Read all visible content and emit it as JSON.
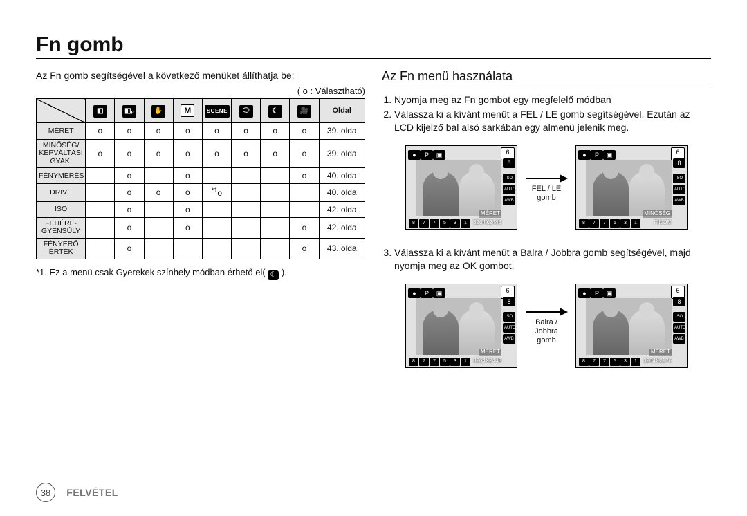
{
  "page": {
    "number": "38",
    "section": "_FELVÉTEL",
    "title": "Fn gomb"
  },
  "left": {
    "intro": "Az Fn gomb segítségével a következő menüket állíthatja be:",
    "legend": "( o : Választható)",
    "table": {
      "page_header": "Oldal",
      "mode_icons": [
        "camera",
        "camera-p",
        "hand",
        "m",
        "scene",
        "balloon",
        "night",
        "movie"
      ],
      "rows": [
        {
          "label": "MÉRET",
          "cells": [
            "o",
            "o",
            "o",
            "o",
            "o",
            "o",
            "o",
            "o"
          ],
          "page": "39. olda"
        },
        {
          "label": "MINŐSÉG/\nKÉPVÁLTÁSI\nGYAK.",
          "cells": [
            "o",
            "o",
            "o",
            "o",
            "o",
            "o",
            "o",
            "o"
          ],
          "page": "39. olda"
        },
        {
          "label": "FÉNYMÉRÉS",
          "cells": [
            "",
            "o",
            "",
            "o",
            "",
            "",
            "",
            "o"
          ],
          "page": "40. olda"
        },
        {
          "label": "DRIVE",
          "cells": [
            "",
            "o",
            "o",
            "o",
            "*1o",
            "",
            "",
            ""
          ],
          "page": "40. olda"
        },
        {
          "label": "ISO",
          "cells": [
            "",
            "o",
            "",
            "o",
            "",
            "",
            "",
            ""
          ],
          "page": "42. olda"
        },
        {
          "label": "FEHÉRE-\nGYENSÚLY",
          "cells": [
            "",
            "o",
            "",
            "o",
            "",
            "",
            "",
            "o"
          ],
          "page": "42. olda"
        },
        {
          "label": "FÉNYERŐ\nÉRTÉK",
          "cells": [
            "",
            "o",
            "",
            "",
            "",
            "",
            "",
            "o"
          ],
          "page": "43. olda"
        }
      ]
    },
    "footnote_prefix": "*1. Ez a menü csak Gyerekek színhely módban érhető el( ",
    "footnote_suffix": " )."
  },
  "right": {
    "heading": "Az Fn menü használata",
    "step1": "Nyomja meg az Fn gombot egy megfelelő módban",
    "step2": "Válassza ki a kívánt menüt a FEL / LE gomb segítségével. Ezután az LCD kijelző bal alsó sarkában egy almenü jelenik meg.",
    "step3": "Válassza ki a kívánt menüt a Balra / Jobbra gomb segítségével, majd nyomja meg az OK gombot.",
    "fig1": {
      "arrow_label": "FEL / LE\ngomb",
      "left_lcd": {
        "bottom_label": "MÉRET",
        "res": "3264X2448",
        "iso": "ISO\nAUTO",
        "awb": "AWB"
      },
      "right_lcd": {
        "bottom_label": "MINŐSÉG",
        "res": "FINOM",
        "iso": "ISO\nAUTO",
        "awb": "AWB"
      }
    },
    "fig2": {
      "arrow_label": "Balra /\nJobbra\ngomb",
      "left_lcd": {
        "bottom_label": "MÉRET",
        "res": "3264X2448",
        "iso": "ISO\nAUTO",
        "awb": "AWB"
      },
      "right_lcd": {
        "bottom_label": "MÉRET",
        "res": "3264X2176",
        "iso": "ISO\nAUTO",
        "awb": "AWB"
      }
    },
    "lcd_common": {
      "eight": "8",
      "size_chips": [
        "8",
        "7",
        "7",
        "5",
        "3",
        "1"
      ],
      "top_left_icons": [
        "●",
        "P",
        "▣"
      ],
      "top_right_num": "6"
    }
  }
}
